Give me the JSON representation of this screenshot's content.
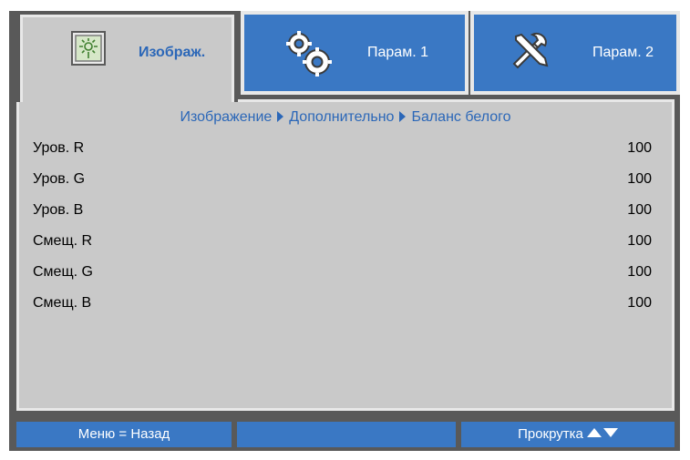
{
  "tabs": [
    {
      "label": "Изображ.",
      "icon": "picture-icon",
      "active": true
    },
    {
      "label": "Парам. 1",
      "icon": "gears-icon",
      "active": false
    },
    {
      "label": "Парам. 2",
      "icon": "tools-icon",
      "active": false
    }
  ],
  "breadcrumb": [
    "Изображение",
    "Дополнительно",
    "Баланс белого"
  ],
  "settings": [
    {
      "label": "Уров. R",
      "value": "100"
    },
    {
      "label": "Уров. G",
      "value": "100"
    },
    {
      "label": "Уров. B",
      "value": "100"
    },
    {
      "label": "Смещ. R",
      "value": "100"
    },
    {
      "label": "Смещ. G",
      "value": "100"
    },
    {
      "label": "Смещ. B",
      "value": "100"
    }
  ],
  "footer": {
    "menu_label": "Меню = Назад",
    "middle_label": "",
    "scroll_label": "Прокрутка"
  },
  "colors": {
    "accent": "#3a78c4",
    "frame": "#595959",
    "panel": "#c9c9c9",
    "label_blue": "#2b67b8"
  }
}
